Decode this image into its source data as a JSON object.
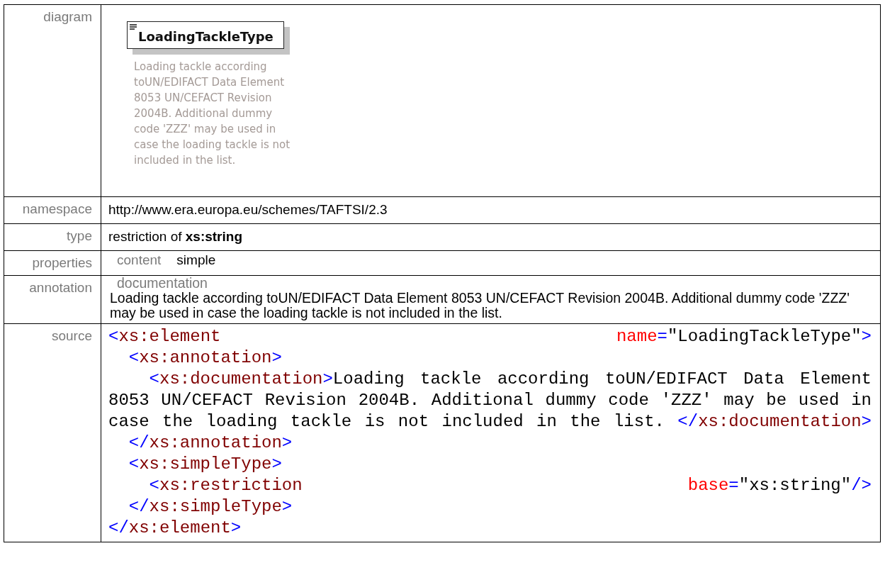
{
  "rows": [
    {
      "kind": "diagram",
      "label": "diagram",
      "element": {
        "name": "LoadingTackleType",
        "documentation": "Loading tackle according toUN/EDIFACT Data Element 8053 UN/CEFACT Revision 2004B. Additional dummy code 'ZZZ' may be used in case the loading tackle is not included in the list."
      }
    },
    {
      "kind": "text",
      "label": "namespace",
      "value": "http://www.era.europa.eu/schemes/TAFTSI/2.3"
    },
    {
      "kind": "text",
      "label": "type",
      "value": "restriction of **xs:string**"
    },
    {
      "kind": "properties",
      "label": "properties",
      "items": [
        {
          "key": "content",
          "value": "simple"
        }
      ]
    },
    {
      "kind": "annotation",
      "label": "annotation",
      "title": "documentation",
      "text": "Loading tackle according toUN/EDIFACT Data Element 8053 UN/CEFACT Revision 2004B. Additional dummy code 'ZZZ' may be used in case the loading tackle is not included in the list."
    },
    {
      "kind": "source",
      "label": "source",
      "lines": [
        [
          {
            "kind": "punct",
            "text": "<"
          },
          {
            "kind": "tag",
            "text": "xs:element"
          },
          {
            "kind": "attr",
            "text": " name"
          },
          {
            "kind": "punct",
            "text": "="
          },
          {
            "kind": "value",
            "text": "\"LoadingTackleType\""
          },
          {
            "kind": "punct",
            "text": ">"
          }
        ],
        [
          {
            "kind": "punct",
            "text": "  <"
          },
          {
            "kind": "tag",
            "text": "xs:annotation"
          },
          {
            "kind": "punct",
            "text": ">"
          }
        ],
        [
          {
            "kind": "punct",
            "text": "    <"
          },
          {
            "kind": "tag",
            "text": "xs:documentation"
          },
          {
            "kind": "punct",
            "text": ">"
          },
          {
            "kind": "text",
            "text": "Loading tackle according toUN/EDIFACT Data Element"
          }
        ],
        [
          {
            "kind": "text",
            "text": "8053 UN/CEFACT Revision 2004B. Additional dummy code 'ZZZ' may be used in"
          }
        ],
        [
          {
            "kind": "text",
            "text": "case the loading tackle is not included in the list. "
          },
          {
            "kind": "punct",
            "text": "</"
          },
          {
            "kind": "tag",
            "text": "xs:documentation"
          },
          {
            "kind": "punct",
            "text": ">"
          }
        ],
        [
          {
            "kind": "punct",
            "text": "  </"
          },
          {
            "kind": "tag",
            "text": "xs:annotation"
          },
          {
            "kind": "punct",
            "text": ">"
          }
        ],
        [
          {
            "kind": "punct",
            "text": "  <"
          },
          {
            "kind": "tag",
            "text": "xs:simpleType"
          },
          {
            "kind": "punct",
            "text": ">"
          }
        ],
        [
          {
            "kind": "punct",
            "text": "    <"
          },
          {
            "kind": "tag",
            "text": "xs:restriction"
          },
          {
            "kind": "attr",
            "text": " base"
          },
          {
            "kind": "punct",
            "text": "="
          },
          {
            "kind": "value",
            "text": "\"xs:string\""
          },
          {
            "kind": "punct",
            "text": "/>"
          }
        ],
        [
          {
            "kind": "punct",
            "text": "  </"
          },
          {
            "kind": "tag",
            "text": "xs:simpleType"
          },
          {
            "kind": "punct",
            "text": ">"
          }
        ],
        [
          {
            "kind": "punct",
            "text": "</"
          },
          {
            "kind": "tag",
            "text": "xs:element"
          },
          {
            "kind": "punct",
            "text": ">"
          }
        ]
      ]
    }
  ]
}
